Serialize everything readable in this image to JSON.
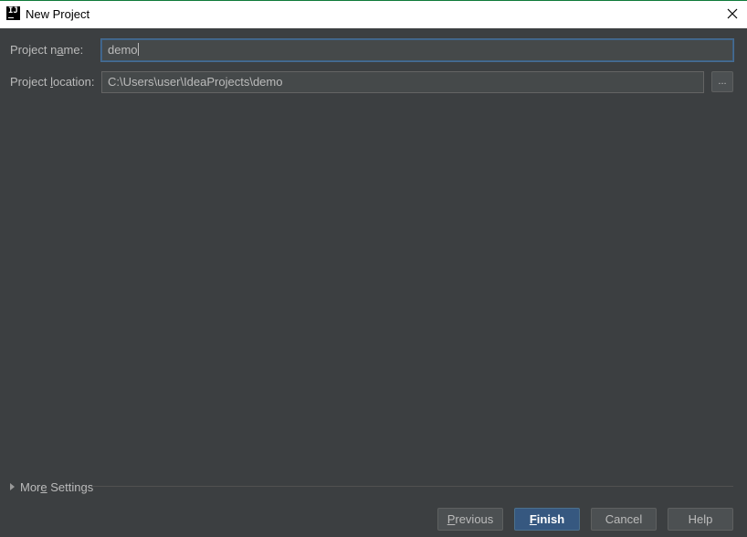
{
  "window": {
    "title": "New Project",
    "app_icon_glyph": "IJ",
    "close_icon": "close-icon"
  },
  "form": {
    "project_name": {
      "label_before": "Project n",
      "label_mnemonic": "a",
      "label_after": "me:",
      "value": "demo"
    },
    "project_location": {
      "label_before": "Project ",
      "label_mnemonic": "l",
      "label_after": "ocation:",
      "value": "C:\\Users\\user\\IdeaProjects\\demo"
    },
    "browse_label": "..."
  },
  "more_settings": {
    "label_before": "Mor",
    "label_mnemonic": "e",
    "label_after": " Settings",
    "expand_icon": "triangle-right-icon"
  },
  "buttons": {
    "previous": {
      "mnemonic": "P",
      "rest": "revious"
    },
    "finish": {
      "mnemonic": "F",
      "rest": "inish"
    },
    "cancel": "Cancel",
    "help": "Help"
  },
  "colors": {
    "background": "#3c3f41",
    "titlebar": "#ffffff",
    "field_bg": "#45494a",
    "focus_border": "#466d94",
    "default_button": "#365880",
    "text": "#bbbbbb"
  }
}
